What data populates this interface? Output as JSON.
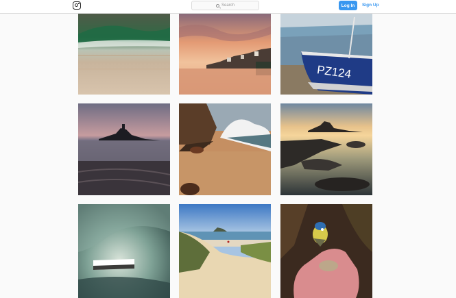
{
  "header": {
    "logo_icon": "instagram-icon",
    "search": {
      "placeholder": "Search",
      "icon": "search-icon"
    },
    "login_label": "Log In",
    "signup_label": "Sign Up",
    "accent_color": "#3897f0"
  },
  "grid": {
    "photos": [
      {
        "subject": "wave-motion-blur"
      },
      {
        "subject": "harbour-town-sunset"
      },
      {
        "subject": "fishing-boat-pz124",
        "boat_label": "PZ124"
      },
      {
        "subject": "island-castle-dusk"
      },
      {
        "subject": "cliff-beach-wave"
      },
      {
        "subject": "island-castle-rocks"
      },
      {
        "subject": "wave-tube"
      },
      {
        "subject": "dunes-beach"
      },
      {
        "subject": "blue-tit-on-hand"
      }
    ]
  }
}
